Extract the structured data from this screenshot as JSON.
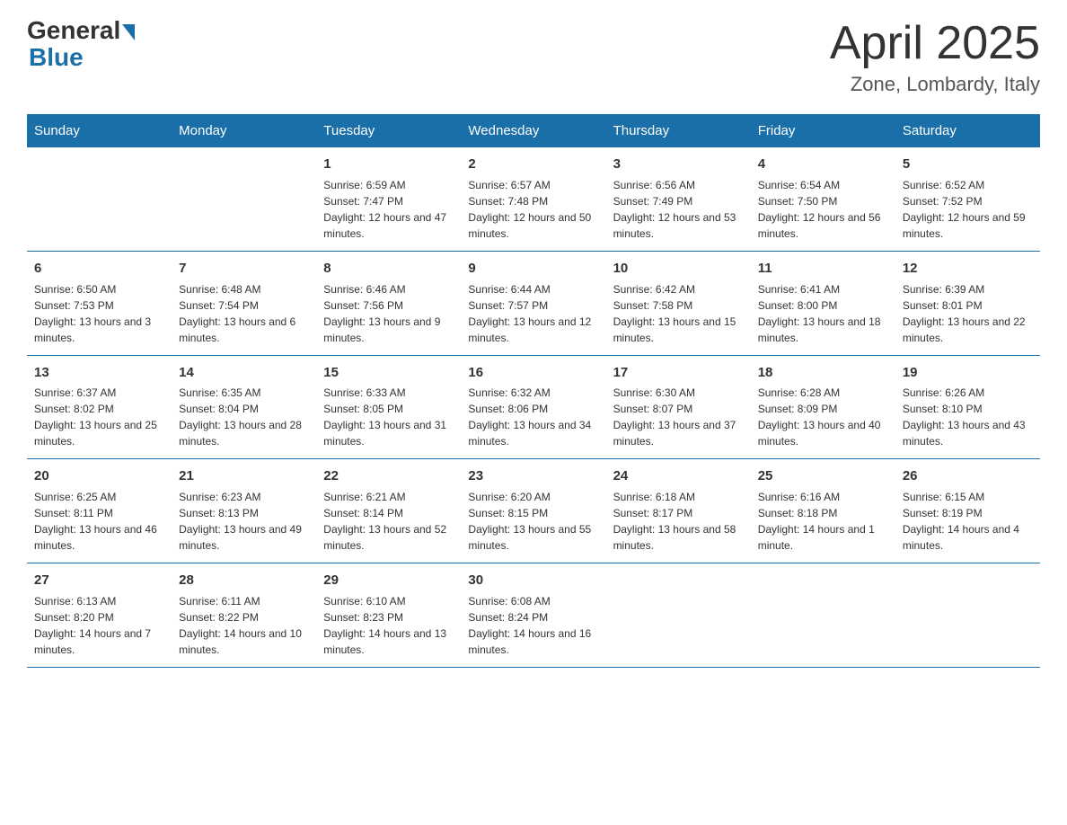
{
  "header": {
    "title": "April 2025",
    "subtitle": "Zone, Lombardy, Italy",
    "logo_general": "General",
    "logo_blue": "Blue"
  },
  "weekdays": [
    "Sunday",
    "Monday",
    "Tuesday",
    "Wednesday",
    "Thursday",
    "Friday",
    "Saturday"
  ],
  "weeks": [
    [
      {
        "day": "",
        "sunrise": "",
        "sunset": "",
        "daylight": ""
      },
      {
        "day": "",
        "sunrise": "",
        "sunset": "",
        "daylight": ""
      },
      {
        "day": "1",
        "sunrise": "Sunrise: 6:59 AM",
        "sunset": "Sunset: 7:47 PM",
        "daylight": "Daylight: 12 hours and 47 minutes."
      },
      {
        "day": "2",
        "sunrise": "Sunrise: 6:57 AM",
        "sunset": "Sunset: 7:48 PM",
        "daylight": "Daylight: 12 hours and 50 minutes."
      },
      {
        "day": "3",
        "sunrise": "Sunrise: 6:56 AM",
        "sunset": "Sunset: 7:49 PM",
        "daylight": "Daylight: 12 hours and 53 minutes."
      },
      {
        "day": "4",
        "sunrise": "Sunrise: 6:54 AM",
        "sunset": "Sunset: 7:50 PM",
        "daylight": "Daylight: 12 hours and 56 minutes."
      },
      {
        "day": "5",
        "sunrise": "Sunrise: 6:52 AM",
        "sunset": "Sunset: 7:52 PM",
        "daylight": "Daylight: 12 hours and 59 minutes."
      }
    ],
    [
      {
        "day": "6",
        "sunrise": "Sunrise: 6:50 AM",
        "sunset": "Sunset: 7:53 PM",
        "daylight": "Daylight: 13 hours and 3 minutes."
      },
      {
        "day": "7",
        "sunrise": "Sunrise: 6:48 AM",
        "sunset": "Sunset: 7:54 PM",
        "daylight": "Daylight: 13 hours and 6 minutes."
      },
      {
        "day": "8",
        "sunrise": "Sunrise: 6:46 AM",
        "sunset": "Sunset: 7:56 PM",
        "daylight": "Daylight: 13 hours and 9 minutes."
      },
      {
        "day": "9",
        "sunrise": "Sunrise: 6:44 AM",
        "sunset": "Sunset: 7:57 PM",
        "daylight": "Daylight: 13 hours and 12 minutes."
      },
      {
        "day": "10",
        "sunrise": "Sunrise: 6:42 AM",
        "sunset": "Sunset: 7:58 PM",
        "daylight": "Daylight: 13 hours and 15 minutes."
      },
      {
        "day": "11",
        "sunrise": "Sunrise: 6:41 AM",
        "sunset": "Sunset: 8:00 PM",
        "daylight": "Daylight: 13 hours and 18 minutes."
      },
      {
        "day": "12",
        "sunrise": "Sunrise: 6:39 AM",
        "sunset": "Sunset: 8:01 PM",
        "daylight": "Daylight: 13 hours and 22 minutes."
      }
    ],
    [
      {
        "day": "13",
        "sunrise": "Sunrise: 6:37 AM",
        "sunset": "Sunset: 8:02 PM",
        "daylight": "Daylight: 13 hours and 25 minutes."
      },
      {
        "day": "14",
        "sunrise": "Sunrise: 6:35 AM",
        "sunset": "Sunset: 8:04 PM",
        "daylight": "Daylight: 13 hours and 28 minutes."
      },
      {
        "day": "15",
        "sunrise": "Sunrise: 6:33 AM",
        "sunset": "Sunset: 8:05 PM",
        "daylight": "Daylight: 13 hours and 31 minutes."
      },
      {
        "day": "16",
        "sunrise": "Sunrise: 6:32 AM",
        "sunset": "Sunset: 8:06 PM",
        "daylight": "Daylight: 13 hours and 34 minutes."
      },
      {
        "day": "17",
        "sunrise": "Sunrise: 6:30 AM",
        "sunset": "Sunset: 8:07 PM",
        "daylight": "Daylight: 13 hours and 37 minutes."
      },
      {
        "day": "18",
        "sunrise": "Sunrise: 6:28 AM",
        "sunset": "Sunset: 8:09 PM",
        "daylight": "Daylight: 13 hours and 40 minutes."
      },
      {
        "day": "19",
        "sunrise": "Sunrise: 6:26 AM",
        "sunset": "Sunset: 8:10 PM",
        "daylight": "Daylight: 13 hours and 43 minutes."
      }
    ],
    [
      {
        "day": "20",
        "sunrise": "Sunrise: 6:25 AM",
        "sunset": "Sunset: 8:11 PM",
        "daylight": "Daylight: 13 hours and 46 minutes."
      },
      {
        "day": "21",
        "sunrise": "Sunrise: 6:23 AM",
        "sunset": "Sunset: 8:13 PM",
        "daylight": "Daylight: 13 hours and 49 minutes."
      },
      {
        "day": "22",
        "sunrise": "Sunrise: 6:21 AM",
        "sunset": "Sunset: 8:14 PM",
        "daylight": "Daylight: 13 hours and 52 minutes."
      },
      {
        "day": "23",
        "sunrise": "Sunrise: 6:20 AM",
        "sunset": "Sunset: 8:15 PM",
        "daylight": "Daylight: 13 hours and 55 minutes."
      },
      {
        "day": "24",
        "sunrise": "Sunrise: 6:18 AM",
        "sunset": "Sunset: 8:17 PM",
        "daylight": "Daylight: 13 hours and 58 minutes."
      },
      {
        "day": "25",
        "sunrise": "Sunrise: 6:16 AM",
        "sunset": "Sunset: 8:18 PM",
        "daylight": "Daylight: 14 hours and 1 minute."
      },
      {
        "day": "26",
        "sunrise": "Sunrise: 6:15 AM",
        "sunset": "Sunset: 8:19 PM",
        "daylight": "Daylight: 14 hours and 4 minutes."
      }
    ],
    [
      {
        "day": "27",
        "sunrise": "Sunrise: 6:13 AM",
        "sunset": "Sunset: 8:20 PM",
        "daylight": "Daylight: 14 hours and 7 minutes."
      },
      {
        "day": "28",
        "sunrise": "Sunrise: 6:11 AM",
        "sunset": "Sunset: 8:22 PM",
        "daylight": "Daylight: 14 hours and 10 minutes."
      },
      {
        "day": "29",
        "sunrise": "Sunrise: 6:10 AM",
        "sunset": "Sunset: 8:23 PM",
        "daylight": "Daylight: 14 hours and 13 minutes."
      },
      {
        "day": "30",
        "sunrise": "Sunrise: 6:08 AM",
        "sunset": "Sunset: 8:24 PM",
        "daylight": "Daylight: 14 hours and 16 minutes."
      },
      {
        "day": "",
        "sunrise": "",
        "sunset": "",
        "daylight": ""
      },
      {
        "day": "",
        "sunrise": "",
        "sunset": "",
        "daylight": ""
      },
      {
        "day": "",
        "sunrise": "",
        "sunset": "",
        "daylight": ""
      }
    ]
  ]
}
